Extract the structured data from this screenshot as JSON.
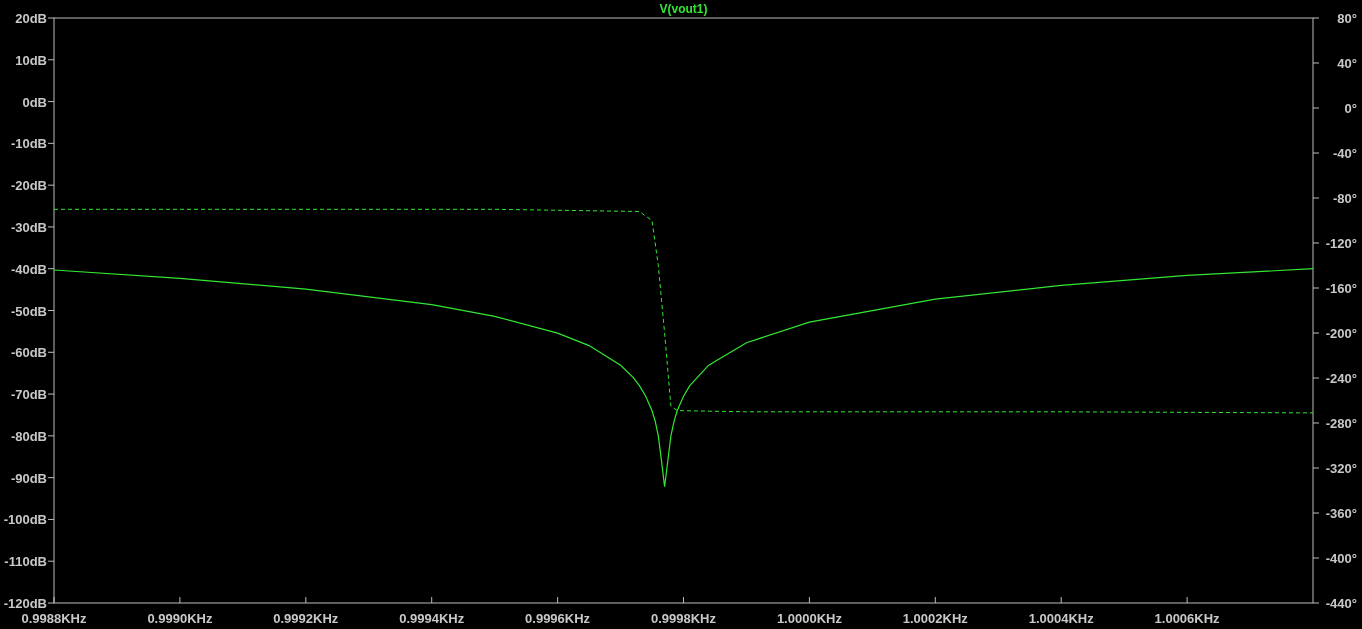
{
  "plot": {
    "chart_data": {
      "type": "line",
      "title": "V(vout1)",
      "xlim": [
        0.9988,
        1.0008
      ],
      "ylim": [
        -120,
        20
      ],
      "xticks": [
        {
          "value": 0.9988,
          "label": "0.9988KHz"
        },
        {
          "value": 0.999,
          "label": "0.9990KHz"
        },
        {
          "value": 0.9992,
          "label": "0.9992KHz"
        },
        {
          "value": 0.9994,
          "label": "0.9994KHz"
        },
        {
          "value": 0.9996,
          "label": "0.9996KHz"
        },
        {
          "value": 0.9998,
          "label": "0.9998KHz"
        },
        {
          "value": 1.0,
          "label": "1.0000KHz"
        },
        {
          "value": 1.0002,
          "label": "1.0002KHz"
        },
        {
          "value": 1.0004,
          "label": "1.0004KHz"
        },
        {
          "value": 1.0006,
          "label": "1.0006KHz"
        }
      ],
      "yticks": [
        {
          "value": 20,
          "label": "20dB"
        },
        {
          "value": 10,
          "label": "10dB"
        },
        {
          "value": 0,
          "label": "0dB"
        },
        {
          "value": -10,
          "label": "-10dB"
        },
        {
          "value": -20,
          "label": "-20dB"
        },
        {
          "value": -30,
          "label": "-30dB"
        },
        {
          "value": -40,
          "label": "-40dB"
        },
        {
          "value": -50,
          "label": "-50dB"
        },
        {
          "value": -60,
          "label": "-60dB"
        },
        {
          "value": -70,
          "label": "-70dB"
        },
        {
          "value": -80,
          "label": "-80dB"
        },
        {
          "value": -90,
          "label": "-90dB"
        },
        {
          "value": -100,
          "label": "-100dB"
        },
        {
          "value": -110,
          "label": "-110dB"
        },
        {
          "value": -120,
          "label": "-120dB"
        }
      ],
      "x": [
        0.9988,
        0.999,
        0.9992,
        0.9994,
        0.9995,
        0.9996,
        0.99965,
        0.9997,
        0.99972,
        0.99973,
        0.99974,
        0.99975,
        0.999755,
        0.99976,
        0.999765,
        0.99977,
        0.999775,
        0.99978,
        0.999785,
        0.99979,
        0.9998,
        0.99981,
        0.99984,
        0.9999,
        1.0,
        1.0002,
        1.0004,
        1.0006,
        1.0008
      ],
      "series": [
        {
          "color": "#33e633",
          "values": [
            -40.3,
            -42.3,
            -44.9,
            -48.6,
            -51.4,
            -55.4,
            -58.4,
            -63.1,
            -66.0,
            -68.0,
            -70.5,
            -74.0,
            -76.5,
            -80.0,
            -86.0,
            -92.2,
            -86.0,
            -80.0,
            -76.5,
            -74.0,
            -70.5,
            -68.0,
            -63.1,
            -57.7,
            -52.8,
            -47.3,
            -44.0,
            -41.6,
            -40.0
          ]
        }
      ]
    }
  },
  "phase_overlay": {
    "chart_data": {
      "type": "line",
      "xlim": [
        0.9988,
        1.0008
      ],
      "ylim": [
        -440,
        80
      ],
      "yticks": [
        {
          "value": 80,
          "label": "80°"
        },
        {
          "value": 40,
          "label": "40°"
        },
        {
          "value": 0,
          "label": "0°"
        },
        {
          "value": -40,
          "label": "-40°"
        },
        {
          "value": -80,
          "label": "-80°"
        },
        {
          "value": -120,
          "label": "-120°"
        },
        {
          "value": -160,
          "label": "-160°"
        },
        {
          "value": -200,
          "label": "-200°"
        },
        {
          "value": -240,
          "label": "-240°"
        },
        {
          "value": -280,
          "label": "-280°"
        },
        {
          "value": -320,
          "label": "-320°"
        },
        {
          "value": -360,
          "label": "-360°"
        },
        {
          "value": -400,
          "label": "-400°"
        },
        {
          "value": -440,
          "label": "-440°"
        }
      ],
      "x": [
        0.9988,
        0.9992,
        0.9995,
        0.99973,
        0.99975,
        0.99976,
        0.99977,
        0.99978,
        0.99979,
        0.9999,
        1.0004,
        1.0008
      ],
      "series": [
        {
          "color": "#33e633",
          "line_style": "dashed",
          "values": [
            -90,
            -90,
            -90,
            -92,
            -100,
            -140,
            -200,
            -265,
            -269,
            -270,
            -270,
            -271
          ]
        }
      ]
    }
  }
}
